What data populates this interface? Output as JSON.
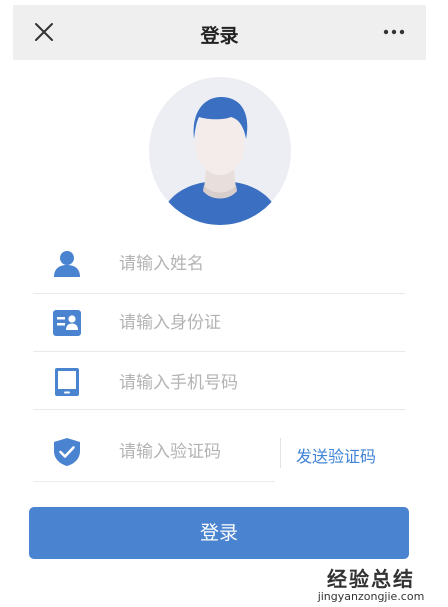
{
  "header": {
    "title": "登录",
    "close_icon": "close-icon",
    "more_icon": "more-icon"
  },
  "avatar": {
    "icon": "user-avatar"
  },
  "form": {
    "name": {
      "placeholder": "请输入姓名",
      "icon": "person-icon"
    },
    "id_card": {
      "placeholder": "请输入身份证",
      "icon": "id-card-icon"
    },
    "phone": {
      "placeholder": "请输入手机号码",
      "icon": "phone-icon"
    },
    "code": {
      "placeholder": "请输入验证码",
      "icon": "shield-check-icon"
    },
    "send_code_label": "发送验证码",
    "submit_label": "登录"
  },
  "colors": {
    "accent": "#4a83cf",
    "link": "#3f84d6",
    "header_bg": "#efefef",
    "placeholder": "#b3b3b3"
  },
  "watermark": {
    "text": "经验总结",
    "url": "jingyanzongjie.com"
  }
}
